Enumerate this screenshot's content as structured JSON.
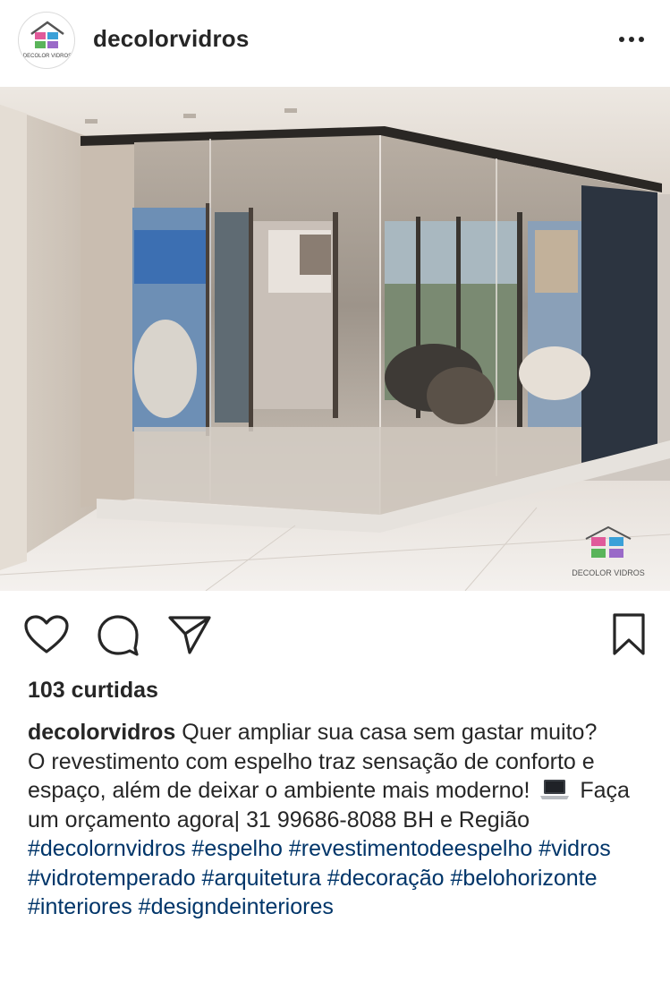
{
  "post": {
    "username": "decolorvidros",
    "avatar_logo_text": "DECOLOR VIDROS",
    "watermark_text": "DECOLOR VIDROS",
    "likes": "103 curtidas",
    "caption_line1": "Quer ampliar sua casa sem gastar muito?",
    "caption_line2a": "O revestimento com espelho traz sensação de conforto e espaço, além de deixar o ambiente mais moderno!",
    "caption_line2b": "Faça um orçamento agora| 31 99686-8088 BH e Região",
    "hashtags": "#decolornvidros #espelho #revestimentodeespelho #vidros #vidrotemperado #arquitetura #decoração #belohorizonte #interiores #designdeinteriores"
  },
  "icons": {
    "more": "more-options-icon",
    "like": "heart-icon",
    "comment": "comment-icon",
    "share": "send-icon",
    "save": "bookmark-icon",
    "emoji": "laptop-emoji-icon"
  },
  "colors": {
    "text": "#262626",
    "hashtag": "#003569",
    "border": "#dbdbdb"
  }
}
